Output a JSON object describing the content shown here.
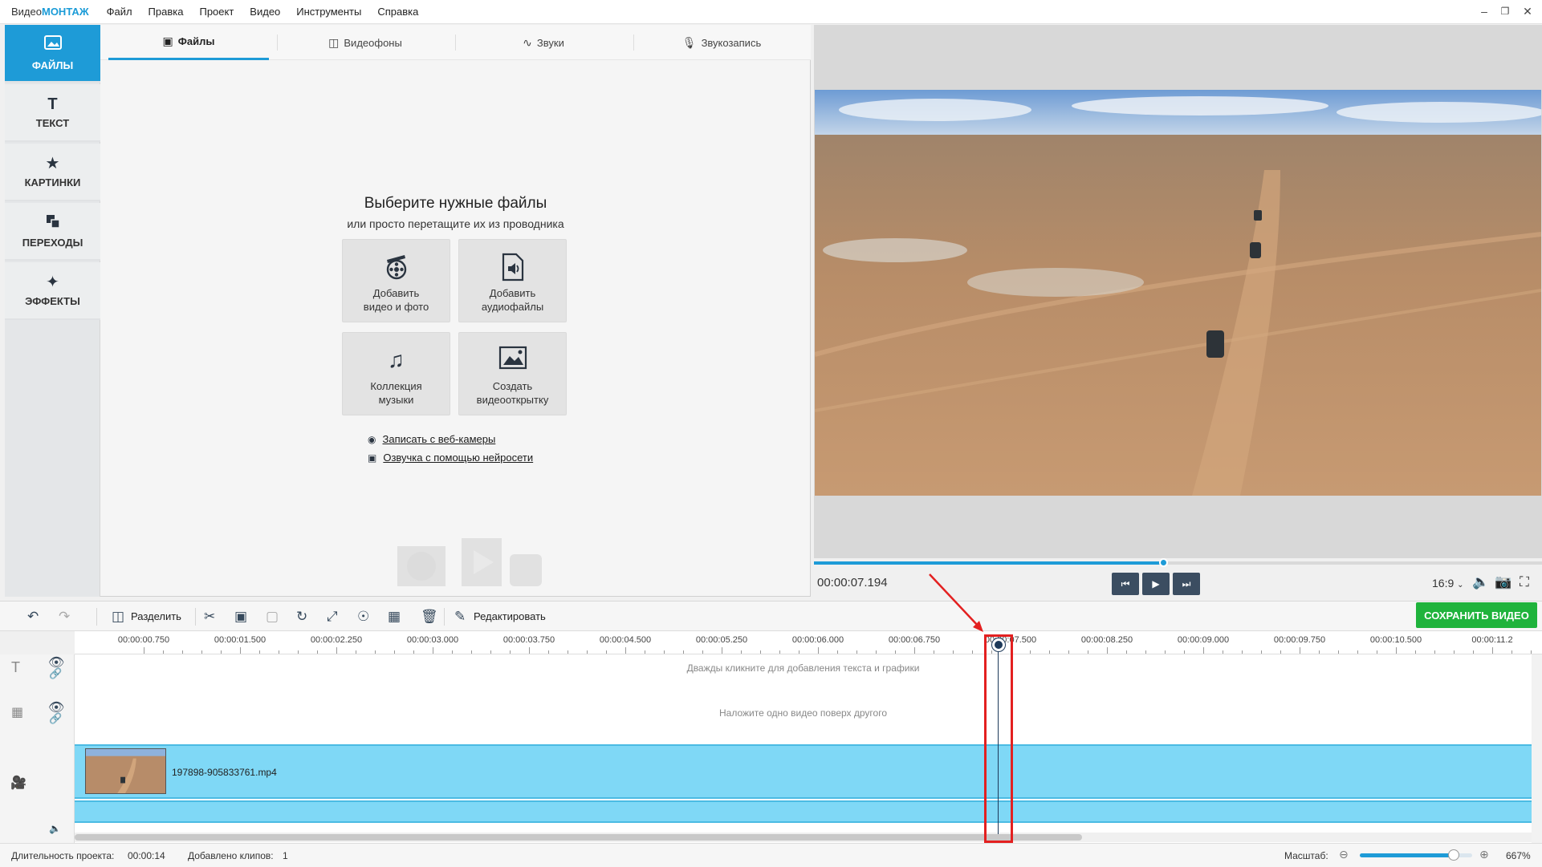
{
  "app": {
    "title_prefix": "Видео",
    "title_brand": "МОНТАЖ"
  },
  "menu": [
    "Файл",
    "Правка",
    "Проект",
    "Видео",
    "Инструменты",
    "Справка"
  ],
  "sidebar": {
    "items": [
      {
        "label": "ФАЙЛЫ",
        "icon": "files-icon",
        "active": true
      },
      {
        "label": "ТЕКСТ",
        "icon": "text-icon"
      },
      {
        "label": "КАРТИНКИ",
        "icon": "star-icon"
      },
      {
        "label": "ПЕРЕХОДЫ",
        "icon": "transitions-icon"
      },
      {
        "label": "ЭФФЕКТЫ",
        "icon": "magic-wand-icon"
      }
    ]
  },
  "tabs": [
    {
      "label": "Файлы",
      "icon": "image-icon",
      "active": true
    },
    {
      "label": "Видеофоны",
      "icon": "video-bg-icon"
    },
    {
      "label": "Звуки",
      "icon": "waveform-icon"
    },
    {
      "label": "Звукозапись",
      "icon": "microphone-icon"
    }
  ],
  "files_panel": {
    "heading": "Выберите нужные файлы",
    "subheading": "или просто перетащите их из проводника",
    "tiles": [
      {
        "line1": "Добавить",
        "line2": "видео и фото",
        "icon": "film-reel-icon"
      },
      {
        "line1": "Добавить",
        "line2": "аудиофайлы",
        "icon": "audio-file-icon"
      },
      {
        "line1": "Коллекция",
        "line2": "музыки",
        "icon": "music-notes-icon"
      },
      {
        "line1": "Создать",
        "line2": "видеооткрытку",
        "icon": "postcard-icon"
      }
    ],
    "links": [
      {
        "label": "Записать с веб-камеры",
        "icon": "webcam-icon"
      },
      {
        "label": "Озвучка с помощью нейросети",
        "icon": "ai-chip-icon"
      }
    ]
  },
  "preview": {
    "time": "00:00:07.194",
    "aspect_ratio": "16:9",
    "progress": 0.48
  },
  "toolbar": {
    "split_label": "Разделить",
    "edit_label": "Редактировать",
    "save_label": "СОХРАНИТЬ ВИДЕО"
  },
  "timeline": {
    "ticks": [
      "00:00:00.750",
      "00:00:01.500",
      "00:00:02.250",
      "00:00:03.000",
      "00:00:03.750",
      "00:00:04.500",
      "00:00:05.250",
      "00:00:06.000",
      "00:00:06.750",
      "00:00:07.500",
      "00:00:08.250",
      "00:00:09.000",
      "00:00:09.750",
      "00:00:10.500",
      "00:00:11.2"
    ],
    "text_track_hint": "Дважды кликните для добавления текста и графики",
    "overlay_track_hint": "Наложите одно видео поверх другого",
    "clip_name": "197898-905833761.mp4"
  },
  "status": {
    "duration_label": "Длительность проекта:",
    "duration_value": "00:00:14",
    "clips_label": "Добавлено клипов:",
    "clips_value": "1",
    "zoom_label": "Масштаб:",
    "zoom_value": "667%"
  },
  "colors": {
    "accent": "#1e9bd7",
    "save": "#1fb33c",
    "highlight": "#e32020",
    "track": "#7fd8f6"
  }
}
